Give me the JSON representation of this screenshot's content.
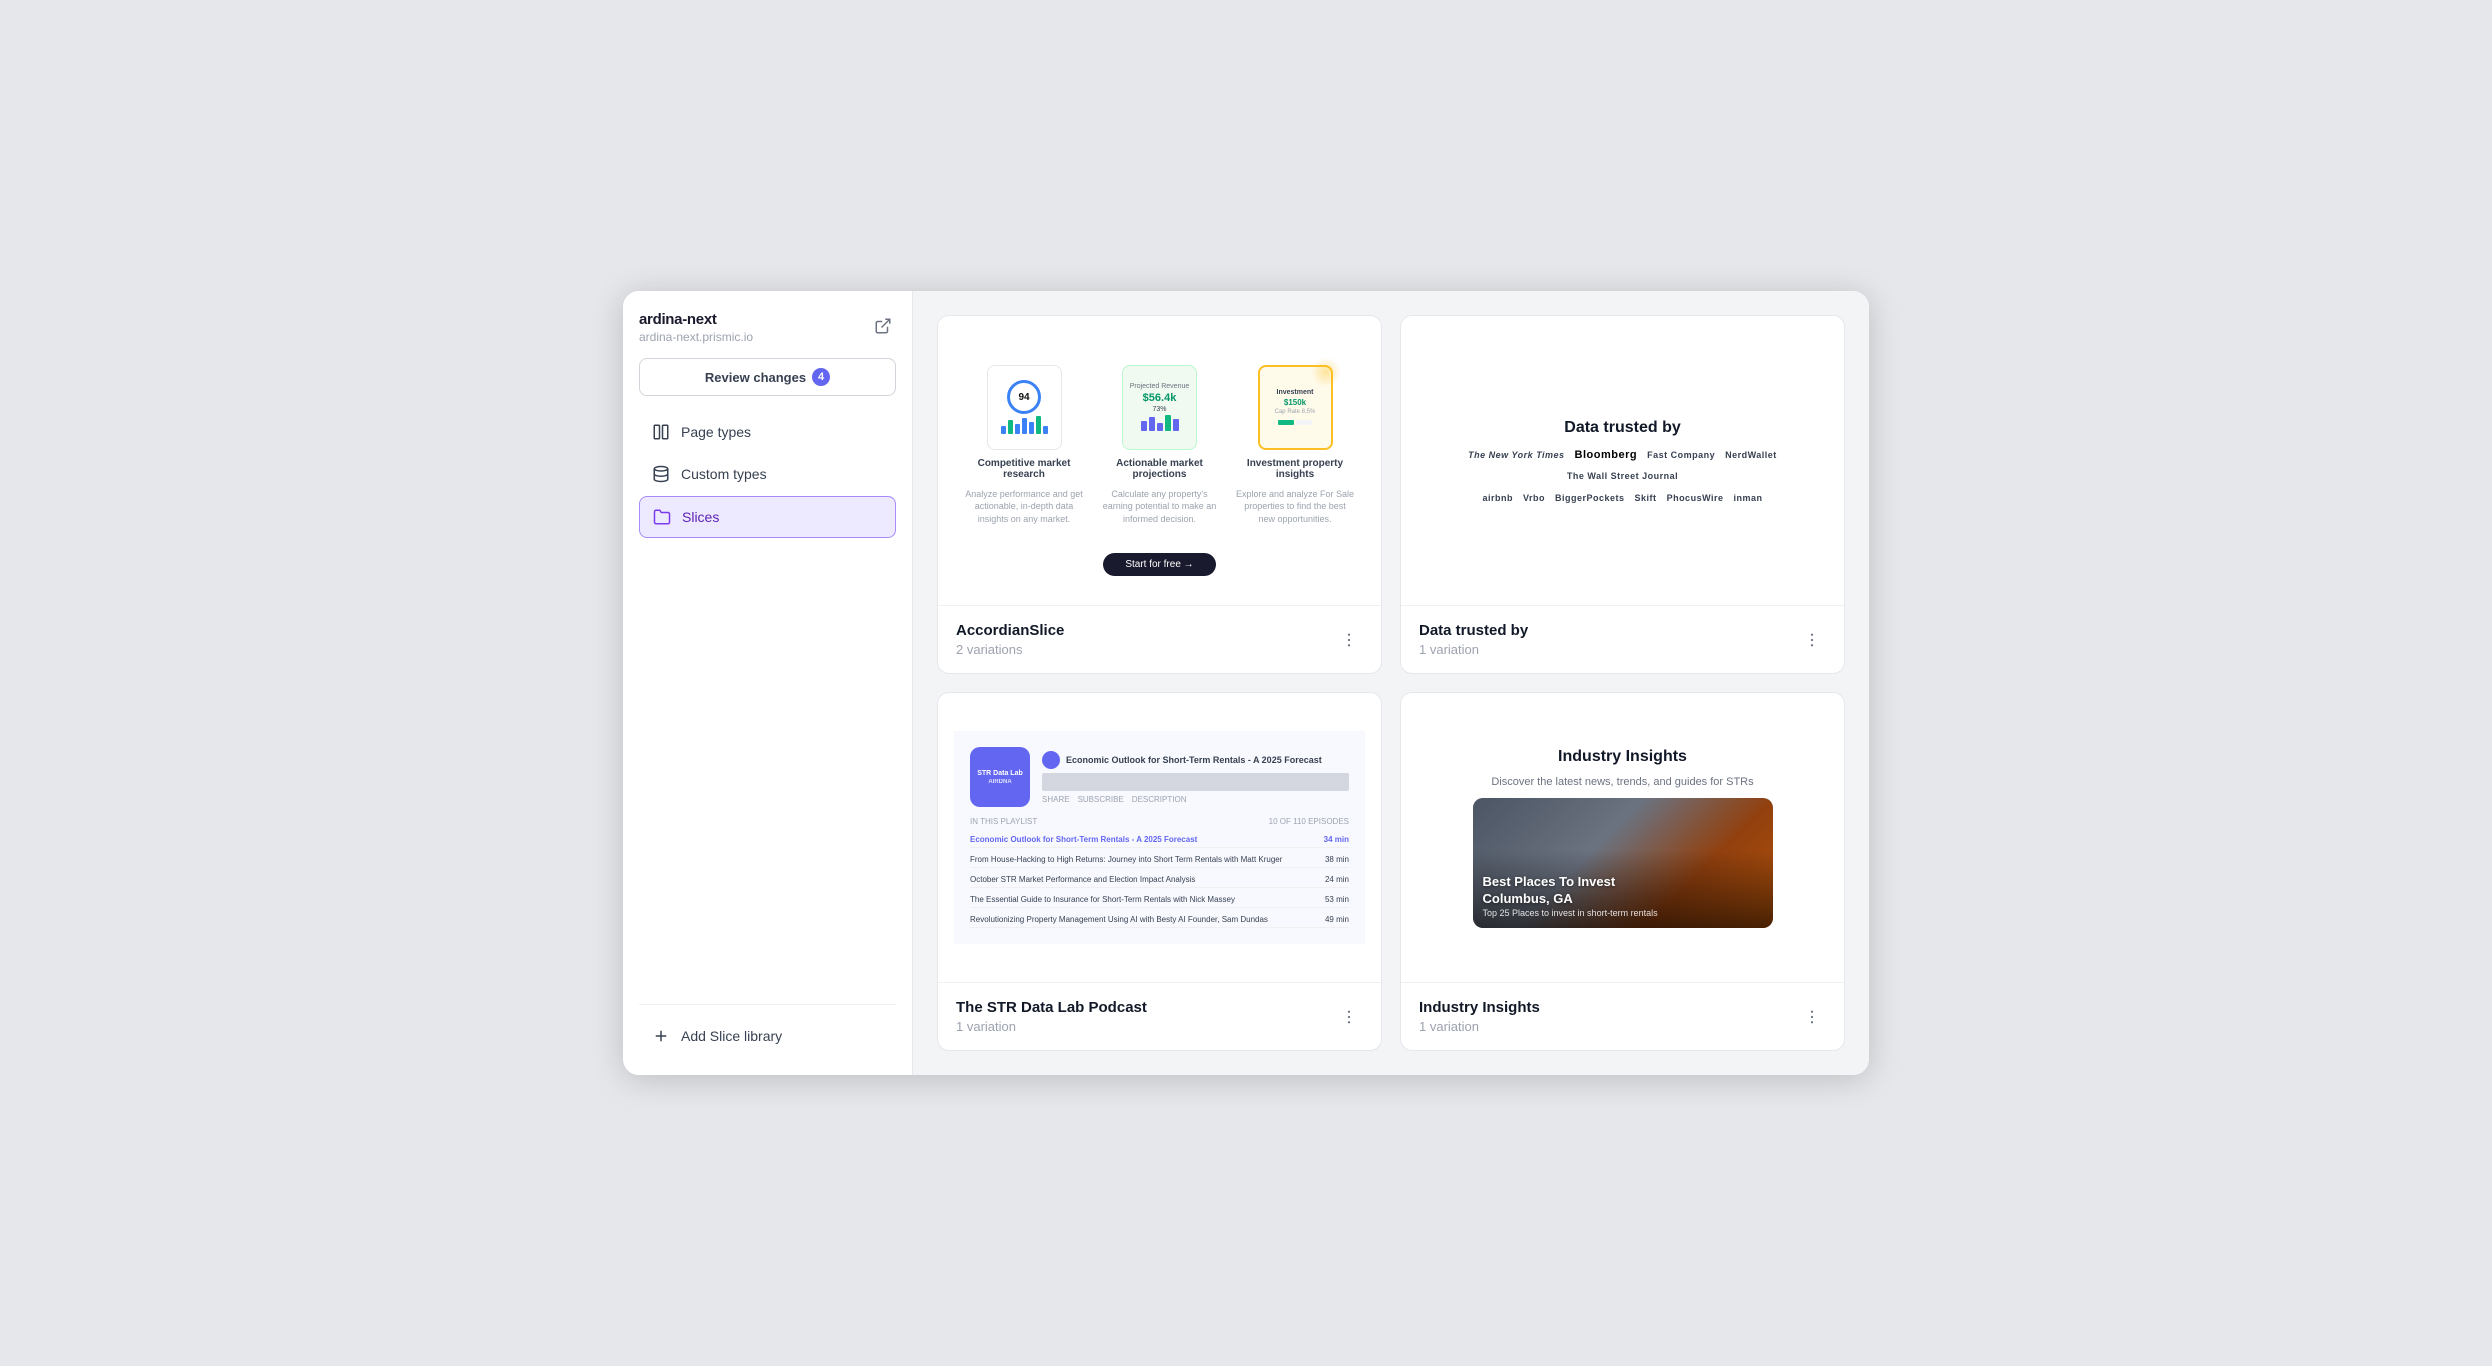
{
  "sidebar": {
    "title": "ardina-next",
    "subtitle": "ardina-next.prismic.io",
    "review_btn": "Review changes",
    "review_count": "4",
    "nav_items": [
      {
        "id": "page-types",
        "label": "Page types",
        "icon": "columns-icon",
        "active": false
      },
      {
        "id": "custom-types",
        "label": "Custom types",
        "icon": "database-icon",
        "active": false
      },
      {
        "id": "slices",
        "label": "Slices",
        "icon": "folder-icon",
        "active": true
      }
    ],
    "bottom_items": [
      {
        "id": "add-slice",
        "label": "Add Slice library",
        "icon": "plus-icon"
      }
    ]
  },
  "main": {
    "cards": [
      {
        "id": "accordion-slice",
        "title": "AccordianSlice",
        "variations": "2 variations",
        "preview_items": [
          {
            "caption": "Competitive market research",
            "desc": "Analyze performance and get actionable, in-depth data insights on any market."
          },
          {
            "caption": "Actionable market projections",
            "desc": "Calculate any property's earning potential to make an informed decision."
          },
          {
            "caption": "Investment property insights",
            "desc": "Explore and analyze For Sale properties to find the best new opportunities."
          }
        ],
        "cta": "Start for free →"
      },
      {
        "id": "data-trusted",
        "title": "Data trusted by",
        "variations": "1 variation",
        "preview_title": "Data trusted by",
        "logos_row1": [
          "The New York Times",
          "Bloomberg",
          "Fast Company",
          "NerdWallet",
          "The Wall Street Journal"
        ],
        "logos_row2": [
          "Airbnb",
          "Vrbo",
          "BiggerPockets",
          "Skift",
          "PhocusWire",
          "inman"
        ]
      },
      {
        "id": "str-podcast",
        "title": "The STR Data Lab Podcast",
        "variations": "1 variation",
        "podcast_logo_line1": "STR Data Lab",
        "podcast_logo_line2": "AIRDNA",
        "podcast_ep": "Economic Outlook for Short-Term Rentals - A 2025 Forecast",
        "playlist_label": "IN THIS PLAYLIST",
        "playlist_count": "10 OF 110 EPISODES",
        "episodes": [
          {
            "title": "Economic Outlook for Short-Term Rentals - A 2025 Forecast",
            "duration": "34 min"
          },
          {
            "title": "From House-Hacking to High Returns: Journey into Short Term Rentals with Matt Kruger",
            "duration": "38 min"
          },
          {
            "title": "October STR Market Performance and Election Impact Analysis",
            "duration": "24 min"
          },
          {
            "title": "The Essential Guide to Insurance for Short-Term Rentals with Nick Massey",
            "duration": "53 min"
          },
          {
            "title": "Revolutionizing Property Management Using AI with Besty AI Founder, Sam Dundas",
            "duration": "49 min"
          }
        ]
      },
      {
        "id": "industry-insights",
        "title": "Industry Insights",
        "variations": "1 variation",
        "preview_title": "Industry Insights",
        "preview_desc": "Discover the latest news, trends, and guides for STRs",
        "img_title": "Best Places To Invest",
        "img_location": "Columbus, GA",
        "img_sub": "Top 25 Places to invest in short-term rentals"
      }
    ]
  }
}
